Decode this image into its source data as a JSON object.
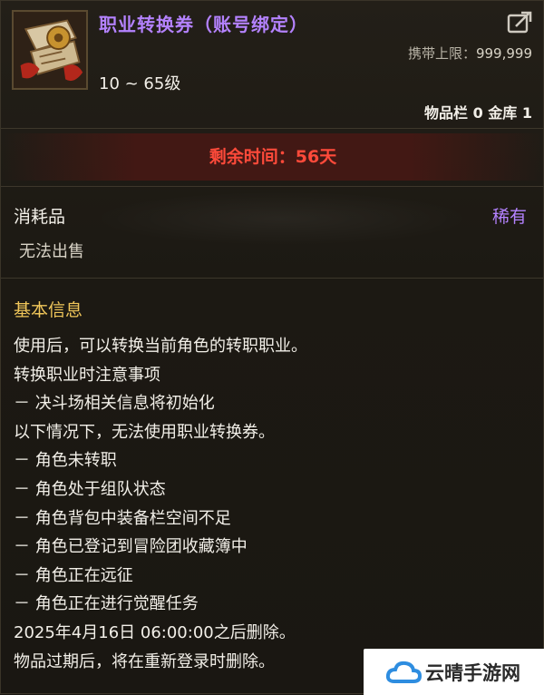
{
  "item": {
    "icon": "class-change-ticket-icon",
    "title": "职业转换券（账号绑定）",
    "level_range": "10 ~ 65级",
    "carry_limit_label": "携带上限：",
    "carry_limit_value": "999,999",
    "storage_text": "物品栏 0 金库 1",
    "remaining_time": "剩余时间：56天",
    "category": "消耗品",
    "rarity": "稀有",
    "sell_status": "无法出售"
  },
  "info": {
    "section_title": "基本信息",
    "lines": [
      "使用后，可以转换当前角色的转职职业。",
      "转换职业时注意事项",
      "－ 决斗场相关信息将初始化",
      "以下情况下，无法使用职业转换券。",
      "－ 角色未转职",
      "－ 角色处于组队状态",
      "－ 角色背包中装备栏空间不足",
      "－ 角色已登记到冒险团收藏簿中",
      "－ 角色正在远征",
      "－ 角色正在进行觉醒任务",
      "2025年4月16日 06:00:00之后删除。",
      "物品过期后，将在重新登录时删除。"
    ]
  },
  "watermark": {
    "text": "云晴手游网",
    "icon": "cloud-logo-icon"
  },
  "colors": {
    "rare_purple": "#b482ff",
    "warning_red": "#ff4a3a",
    "section_gold": "#f0c65a"
  }
}
